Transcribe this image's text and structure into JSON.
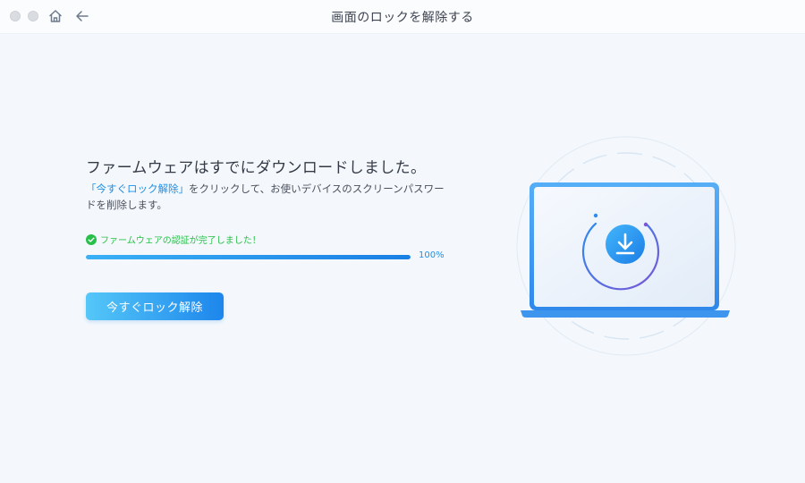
{
  "window": {
    "title": "画面のロックを解除する"
  },
  "nav": {
    "home_icon": "home-icon",
    "back_icon": "arrow-left-icon"
  },
  "main": {
    "heading": "ファームウェアはすでにダウンロードしました。",
    "desc_link": "「今すぐロック解除」",
    "desc_rest": "をクリックして、お使いデバイスのスクリーンパスワードを削除します。",
    "status_text": "ファームウェアの認証が完了しました！",
    "progress": 100,
    "progress_label": "100%",
    "unlock_button": "今すぐロック解除"
  },
  "colors": {
    "accent": "#1c8fe8",
    "success": "#28c04a",
    "background": "#f4f8fc"
  },
  "illustration": {
    "icon": "download-icon",
    "device": "laptop-icon"
  }
}
